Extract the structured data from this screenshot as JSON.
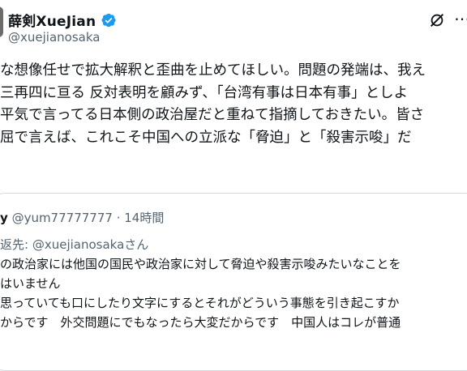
{
  "author": {
    "display_name": "薛剣XueJian",
    "handle": "@xuejianosaka"
  },
  "icons": {
    "verified": "verified-badge-icon",
    "grok": "grok-icon",
    "more": "more-options-icon"
  },
  "colors": {
    "verified_blue": "#1d9bf0",
    "text": "#0f1419",
    "secondary_text": "#536471",
    "border": "#cfd9de"
  },
  "tweet": {
    "lines": [
      "な想像任せで拡大解釈と歪曲を止めてほしい。問題の発端は、我え",
      "三再四に亘る 反対表明を顧みず、「台湾有事は日本有事」としよ",
      "平気で言ってる日本側の政治屋だと重ねて指摘しておきたい。皆さ",
      "屈で言えば、これこそ中国への立派な「脅迫」と「殺害示唆」だ"
    ]
  },
  "quote": {
    "name": "y",
    "handle": "@yum77777777",
    "separator": "·",
    "time": "14時間",
    "reply_prefix": "返先: ",
    "reply_mention": "@xuejianosaka",
    "reply_suffix": "さん",
    "lines": [
      "の政治家には他国の国民や政治家に対して脅迫や殺害示唆みたいなことを",
      "はいません",
      "思っていても口にしたり文字にするとそれがどういう事態を引き起こすか",
      "からです　外交問題にでもなったら大変だからです　中国人はコレが普通"
    ]
  }
}
